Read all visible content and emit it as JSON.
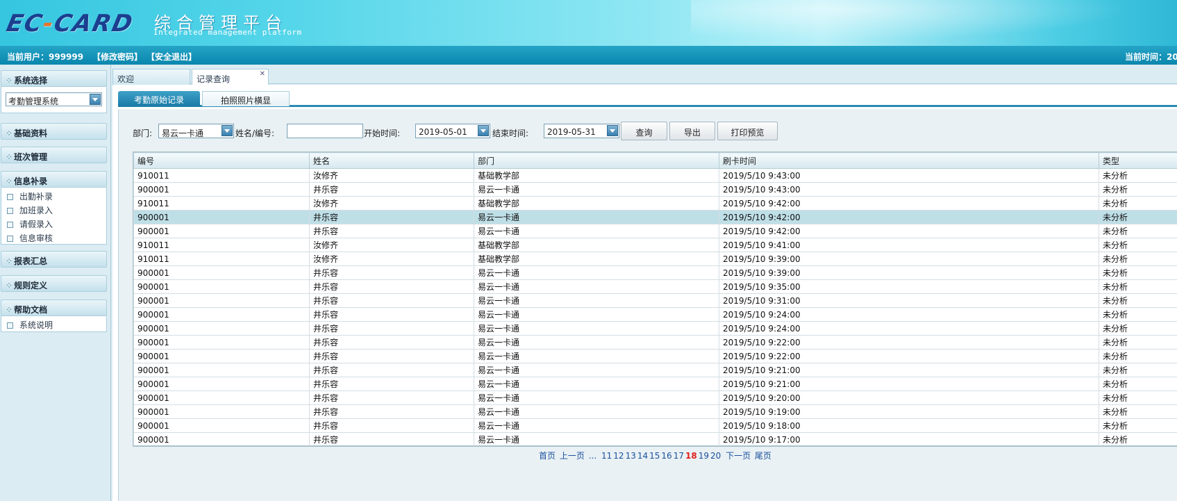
{
  "header": {
    "logo_ec": "EC",
    "logo_dash": "-",
    "logo_card": "CARD",
    "title": "综合管理平台",
    "subtitle": "Integrated management platform"
  },
  "userbar": {
    "current_user": "当前用户：999999",
    "change_password": "【修改密码】",
    "logout": "【安全退出】",
    "current_time": "当前时间：20"
  },
  "sidebar": {
    "system_select_title": "系统选择",
    "system_select_value": "考勤管理系统",
    "sections": {
      "basic": "基础资料",
      "shift": "班次管理",
      "info": "信息补录",
      "report": "报表汇总",
      "rules": "规则定义",
      "help": "帮助文档"
    },
    "info_items": [
      "出勤补录",
      "加班录入",
      "请假录入",
      "信息审核"
    ],
    "help_items": [
      "系统说明"
    ]
  },
  "page_tabs": {
    "welcome": "欢迎",
    "record": "记录查询",
    "close": "✕"
  },
  "sub_tabs": {
    "raw": "考勤原始记录",
    "photo": "拍照照片横显"
  },
  "filters": {
    "dept_label": "部门:",
    "dept_value": "易云一卡通",
    "name_label": "姓名/编号:",
    "name_value": "",
    "start_label": "开始时间:",
    "start_value": "2019-05-01",
    "end_label": "结束时间:",
    "end_value": "2019-05-31",
    "query_btn": "查询",
    "export_btn": "导出",
    "print_btn": "打印预览"
  },
  "table": {
    "columns": [
      "编号",
      "姓名",
      "部门",
      "刷卡时间",
      "类型"
    ],
    "rows": [
      [
        "910011",
        "汝修齐",
        "基础教学部",
        "2019/5/10 9:43:00",
        "未分析"
      ],
      [
        "900001",
        "井乐容",
        "易云一卡通",
        "2019/5/10 9:43:00",
        "未分析"
      ],
      [
        "910011",
        "汝修齐",
        "基础教学部",
        "2019/5/10 9:42:00",
        "未分析"
      ],
      [
        "900001",
        "井乐容",
        "易云一卡通",
        "2019/5/10 9:42:00",
        "未分析"
      ],
      [
        "900001",
        "井乐容",
        "易云一卡通",
        "2019/5/10 9:42:00",
        "未分析"
      ],
      [
        "910011",
        "汝修齐",
        "基础教学部",
        "2019/5/10 9:41:00",
        "未分析"
      ],
      [
        "910011",
        "汝修齐",
        "基础教学部",
        "2019/5/10 9:39:00",
        "未分析"
      ],
      [
        "900001",
        "井乐容",
        "易云一卡通",
        "2019/5/10 9:39:00",
        "未分析"
      ],
      [
        "900001",
        "井乐容",
        "易云一卡通",
        "2019/5/10 9:35:00",
        "未分析"
      ],
      [
        "900001",
        "井乐容",
        "易云一卡通",
        "2019/5/10 9:31:00",
        "未分析"
      ],
      [
        "900001",
        "井乐容",
        "易云一卡通",
        "2019/5/10 9:24:00",
        "未分析"
      ],
      [
        "900001",
        "井乐容",
        "易云一卡通",
        "2019/5/10 9:24:00",
        "未分析"
      ],
      [
        "900001",
        "井乐容",
        "易云一卡通",
        "2019/5/10 9:22:00",
        "未分析"
      ],
      [
        "900001",
        "井乐容",
        "易云一卡通",
        "2019/5/10 9:22:00",
        "未分析"
      ],
      [
        "900001",
        "井乐容",
        "易云一卡通",
        "2019/5/10 9:21:00",
        "未分析"
      ],
      [
        "900001",
        "井乐容",
        "易云一卡通",
        "2019/5/10 9:21:00",
        "未分析"
      ],
      [
        "900001",
        "井乐容",
        "易云一卡通",
        "2019/5/10 9:20:00",
        "未分析"
      ],
      [
        "900001",
        "井乐容",
        "易云一卡通",
        "2019/5/10 9:19:00",
        "未分析"
      ],
      [
        "900001",
        "井乐容",
        "易云一卡通",
        "2019/5/10 9:18:00",
        "未分析"
      ],
      [
        "900001",
        "井乐容",
        "易云一卡通",
        "2019/5/10 9:17:00",
        "未分析"
      ]
    ],
    "selected_row": 3
  },
  "pager": {
    "first": "首页",
    "prev": "上一页",
    "ellipsis": "...",
    "pages": [
      "11",
      "12",
      "13",
      "14",
      "15",
      "16",
      "17",
      "18",
      "19",
      "20"
    ],
    "current": "18",
    "next": "下一页",
    "last": "尾页"
  },
  "colors": {
    "accent": "#1a7ba6",
    "selected_row": "#bfdfe7",
    "current_page": "#e3201b"
  }
}
